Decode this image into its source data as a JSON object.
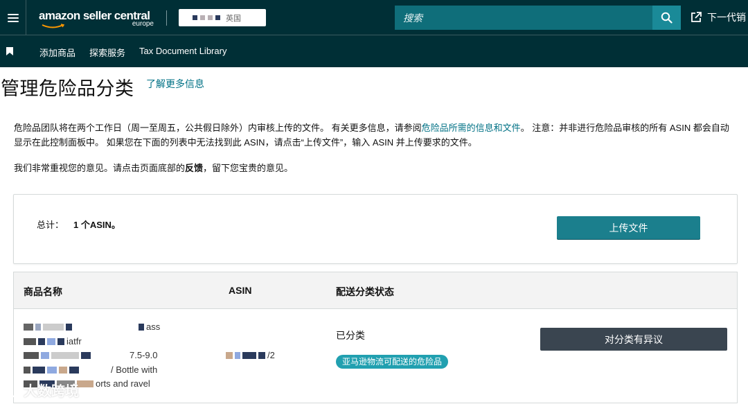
{
  "header": {
    "logo_text": "amazon seller central",
    "logo_region": "europe",
    "store_suffix": "英国",
    "search_placeholder": "搜索",
    "external_link": "下一代销",
    "colors": {
      "bar": "#002f36",
      "search": "#0f6e7a",
      "accent": "#1b7f8d"
    }
  },
  "subnav": {
    "items": [
      "添加商品",
      "探索服务",
      "Tax Document Library"
    ]
  },
  "page": {
    "title": "管理危险品分类",
    "learn_more": "了解更多信息",
    "intro_1a": "危险品团队将在两个工作日（周一至周五，公共假日除外）内审核上传的文件。 有关更多信息，请参阅",
    "intro_1_link": "危险品所需的信息和文件",
    "intro_1b": "。 注意：并非进行危险品审核的所有 ASIN 都会自动显示在此控制面板中。 如果您在下面的列表中无法找到此 ASIN，请点击“上传文件”，输入 ASIN 并上传要求的文件。",
    "intro_2a": "我们非常重视您的意见。请点击页面底部的",
    "intro_2_bold": "反馈",
    "intro_2b": "，留下您宝贵的意见。"
  },
  "summary": {
    "total_label": "总计：",
    "total_value": "1 个ASIN。",
    "upload_button": "上传文件"
  },
  "table": {
    "headers": [
      "商品名称",
      "ASIN",
      "配送分类状态"
    ],
    "rows": [
      {
        "name_lines": [
          "ass",
          "iatfr",
          "7.5-9.0",
          "/ Bottle with",
          "orts and ravel"
        ],
        "asin_tail": "/2",
        "status": "已分类",
        "badge": "亚马逊物流可配送的危险品",
        "action": "对分类有异议"
      }
    ]
  },
  "watermark": "大数跨境",
  "icons": [
    "menu-icon",
    "search-icon",
    "external-link-icon",
    "bookmark-icon"
  ]
}
